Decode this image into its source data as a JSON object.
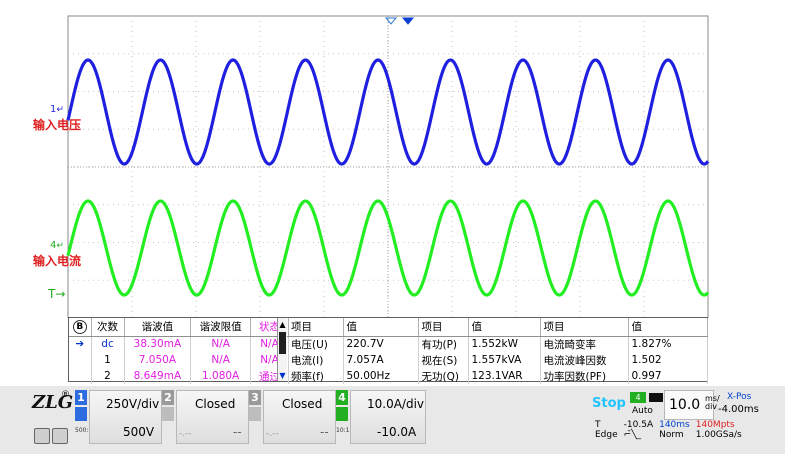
{
  "waveform": {
    "ch1_marker": "1",
    "ch1_name": "输入电压",
    "ch4_marker": "4",
    "ch4_name": "输入电流",
    "trigger_marker": "T",
    "ch1_color": "#1f1fdf",
    "ch4_color": "#22ee22",
    "trigger_marker_color": "#2a7ad4"
  },
  "harmonics": {
    "icon": "B",
    "headers": [
      "次数",
      "谐波值",
      "谐波限值",
      "状态"
    ],
    "rows": [
      {
        "order": "dc",
        "value": "38.30mA",
        "limit": "N/A",
        "status": "N/A",
        "selected": true
      },
      {
        "order": "1",
        "value": "7.050A",
        "limit": "N/A",
        "status": "N/A"
      },
      {
        "order": "2",
        "value": "8.649mA",
        "limit": "1.080A",
        "status": "通过"
      }
    ]
  },
  "power": {
    "headers": [
      "项目",
      "值",
      "项目",
      "值",
      "项目",
      "值"
    ],
    "rows": [
      [
        "电压(U)",
        "220.7V",
        "有功(P)",
        "1.552kW",
        "电流畸变率",
        "1.827%"
      ],
      [
        "电流(I)",
        "7.057A",
        "视在(S)",
        "1.557kVA",
        "电流波峰因数",
        "1.502"
      ],
      [
        "频率(f)",
        "50.00Hz",
        "无功(Q)",
        "123.1VAR",
        "功率因数(PF)",
        "0.997"
      ]
    ]
  },
  "channels": {
    "ch1": {
      "num": "1",
      "scale": "250V/div",
      "offset": "500V",
      "imp": "500:1 1MΩ",
      "color": "#2d6cdf"
    },
    "ch2": {
      "num": "2",
      "state": "Closed",
      "offset": "--",
      "dots": "-.--"
    },
    "ch3": {
      "num": "3",
      "state": "Closed",
      "offset": "--",
      "dots": "-.--"
    },
    "ch4": {
      "num": "4",
      "scale": "10.0A/div",
      "offset": "-10.0A",
      "imp": "10:1 1MΩ",
      "color": "#22b022"
    }
  },
  "acquisition": {
    "status": "Stop",
    "trigger_channel": "4",
    "mode": "Auto",
    "timebase": "10.0",
    "timebase_unit_top": "ms/",
    "timebase_unit_bottom": "div",
    "xpos_label": "X-Pos",
    "xpos_value": "-4.00ms",
    "trigger_label": "T",
    "trigger_level": "-10.5A",
    "window": "140ms",
    "memory": "140Mpts",
    "trigger_type": "Edge",
    "acq_mode": "Norm",
    "sample_rate": "1.00GSa/s"
  },
  "logo": "ZLG"
}
